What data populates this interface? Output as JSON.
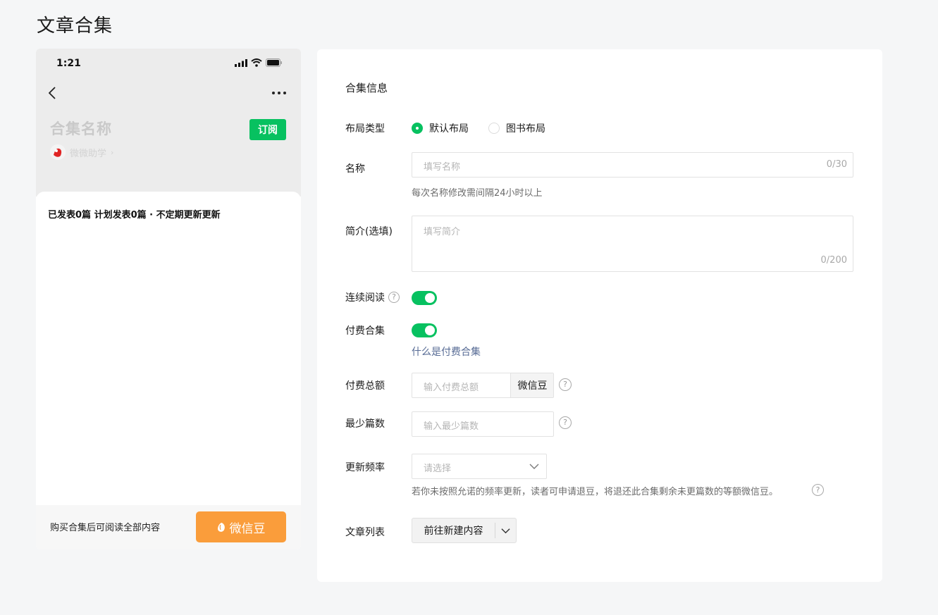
{
  "page": {
    "title": "文章合集"
  },
  "phone": {
    "status_time": "1:21",
    "collection_name": "合集名称",
    "subscribe_label": "订阅",
    "author_name": "微微助学",
    "author_arrow": "›",
    "publish_info": "已发表0篇 计划发表0篇 · 不定期更新更新",
    "footer_text": "购买合集后可阅读全部内容",
    "buy_label": "微信豆"
  },
  "form": {
    "section_title": "合集信息",
    "layout": {
      "label": "布局类型",
      "options": [
        {
          "label": "默认布局",
          "checked": true
        },
        {
          "label": "图书布局",
          "checked": false
        }
      ]
    },
    "name": {
      "label": "名称",
      "placeholder": "填写名称",
      "counter": "0/30",
      "hint": "每次名称修改需间隔24小时以上"
    },
    "intro": {
      "label": "简介(选填)",
      "placeholder": "填写简介",
      "counter": "0/200"
    },
    "continuous_read": {
      "label": "连续阅读",
      "help": "?",
      "on": true
    },
    "paid": {
      "label": "付费合集",
      "help_link": "什么是付费合集",
      "on": true
    },
    "paid_total": {
      "label": "付费总额",
      "placeholder": "输入付费总额",
      "suffix": "微信豆",
      "help": "?"
    },
    "min_count": {
      "label": "最少篇数",
      "placeholder": "输入最少篇数",
      "help": "?"
    },
    "frequency": {
      "label": "更新频率",
      "placeholder": "请选择",
      "hint": "若你未按照允诺的频率更新，读者可申请退豆，将退还此合集剩余未更篇数的等额微信豆。",
      "help": "?"
    },
    "article_list": {
      "label": "文章列表",
      "button_label": "前往新建内容"
    }
  },
  "colors": {
    "brand_green": "#07c160",
    "bean_orange": "#fa9d3b",
    "link_blue": "#576b95"
  }
}
